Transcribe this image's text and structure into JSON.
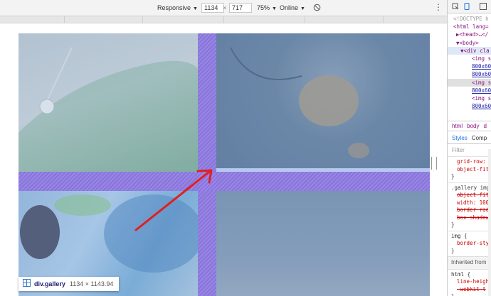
{
  "toolbar": {
    "device": "Responsive",
    "width": "1134",
    "times": "×",
    "height": "717",
    "zoom": "75%",
    "throttle": "Online"
  },
  "gallery_label": {
    "name": "div.gallery",
    "dims": "1134 × 1143.94"
  },
  "devtools": {
    "dom_lines": [
      "<!DOCTYPE h",
      "<html lang=",
      "▶<head>…</",
      "▼<body>",
      "▼<div cla",
      "<img s",
      "800x60",
      "800x60",
      "<img s",
      "800x60",
      "<img s",
      "800x60"
    ],
    "crumbs": [
      "html",
      "body",
      "d"
    ],
    "styles_tabs": [
      "Styles",
      "Comp"
    ],
    "filter": "Filter",
    "rule1": {
      "p1": "grid-row: ",
      "p2": "object-fit"
    },
    "rule2": {
      "selector": ".gallery img",
      "p1": "object-fit",
      "p2": "width: 100",
      "p3": "border-rad",
      "p4": "box-shadow"
    },
    "rule3": {
      "selector": "img {",
      "p1": "border-sty"
    },
    "inherited": "Inherited from",
    "rule4": {
      "selector": "html {",
      "p1": "line-heigh",
      "p2": "-webkit-t"
    }
  }
}
